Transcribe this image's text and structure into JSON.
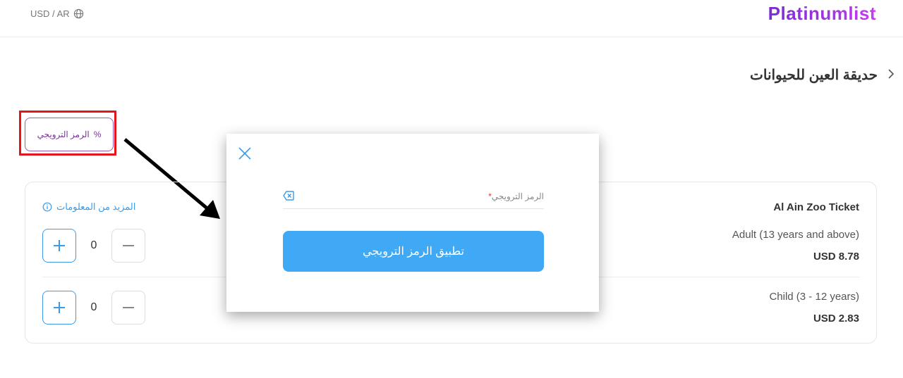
{
  "header": {
    "locale": "USD / AR",
    "logo": "Platinumlist"
  },
  "event": {
    "title": "حديقة العين للحيوانات"
  },
  "promo": {
    "button_label": "الرمز الترويجي",
    "percent_symbol": "%"
  },
  "tickets": {
    "more_info": "المزيد من المعلومات",
    "name": "Al Ain Zoo Ticket",
    "items": [
      {
        "label": "Adult (13 years and above)",
        "price": "USD 8.78",
        "quantity": "0"
      },
      {
        "label": "Child (3 - 12 years)",
        "price": "USD 2.83",
        "quantity": "0"
      }
    ]
  },
  "modal": {
    "field_label": "الرمز الترويجي",
    "required_mark": "*",
    "field_value": "",
    "apply_label": "تطبيق الرمز الترويجي"
  },
  "colors": {
    "accent": "#3fa9f5",
    "highlight": "#e0161a",
    "promo": "#7b2f9c"
  }
}
